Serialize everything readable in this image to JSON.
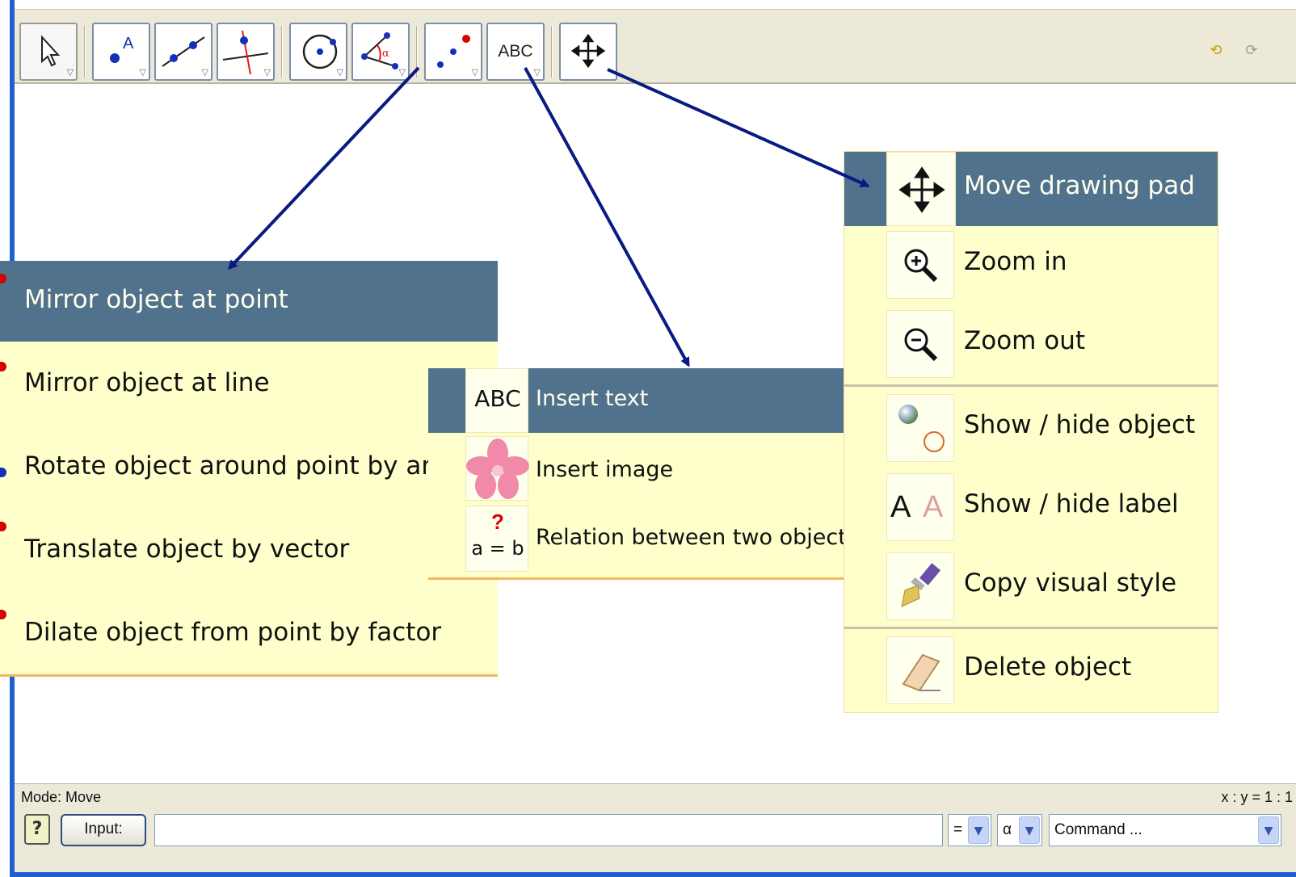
{
  "toolbar": {
    "tools": [
      {
        "name": "move-tool",
        "icon": "cursor-arrow-icon"
      },
      {
        "name": "new-point-tool",
        "icon": "point-A-icon"
      },
      {
        "name": "line-through-two-points-tool",
        "icon": "line-icon"
      },
      {
        "name": "perpendicular-line-tool",
        "icon": "perpendicular-icon"
      },
      {
        "name": "circle-tool",
        "icon": "circle-icon"
      },
      {
        "name": "angle-tool",
        "icon": "angle-alpha-icon"
      },
      {
        "name": "mirror-point-tool",
        "icon": "reflect-points-icon"
      },
      {
        "name": "insert-text-tool",
        "icon": "abc-icon",
        "text": "ABC"
      },
      {
        "name": "move-drawing-pad-tool",
        "icon": "move-cross-icon"
      }
    ],
    "undo_icon": "undo-icon",
    "redo_icon": "redo-icon"
  },
  "menus": {
    "transform": {
      "items": [
        {
          "label": "Mirror object at point",
          "highlighted": true
        },
        {
          "label": "Mirror object at line"
        },
        {
          "label": "Rotate object around point by angle"
        },
        {
          "label": "Translate object by vector"
        },
        {
          "label": "Dilate object from point by factor"
        }
      ]
    },
    "text": {
      "items": [
        {
          "label": "Insert text",
          "icon_text": "ABC",
          "highlighted": true
        },
        {
          "label": "Insert image",
          "icon": "flower-icon"
        },
        {
          "label": "Relation between two objects",
          "icon_text_top": "?",
          "icon_text": "a = b"
        }
      ]
    },
    "move": {
      "items": [
        {
          "label": "Move drawing pad",
          "icon": "move-cross-icon",
          "highlighted": true
        },
        {
          "label": "Zoom in",
          "icon": "zoom-in-icon"
        },
        {
          "label": "Zoom out",
          "icon": "zoom-out-icon"
        },
        {
          "label": "Show / hide object",
          "icon": "show-hide-object-icon"
        },
        {
          "label": "Show / hide label",
          "icon": "show-hide-label-icon",
          "icon_text": "A"
        },
        {
          "label": "Copy visual style",
          "icon": "paintbrush-icon"
        },
        {
          "label": "Delete object",
          "icon": "eraser-icon"
        }
      ]
    }
  },
  "status": {
    "mode": "Mode: Move",
    "ratio": "x : y = 1 : 1"
  },
  "input_bar": {
    "help": "?",
    "input_label": "Input:",
    "input_value": "",
    "symbol_combo": "=",
    "greek_combo": "α",
    "command_combo": "Command ..."
  },
  "colors": {
    "highlight": "#51728c",
    "menu_bg": "#ffffcc",
    "arrow": "#0a1a82",
    "toolbar_bg": "#ece9d8"
  }
}
